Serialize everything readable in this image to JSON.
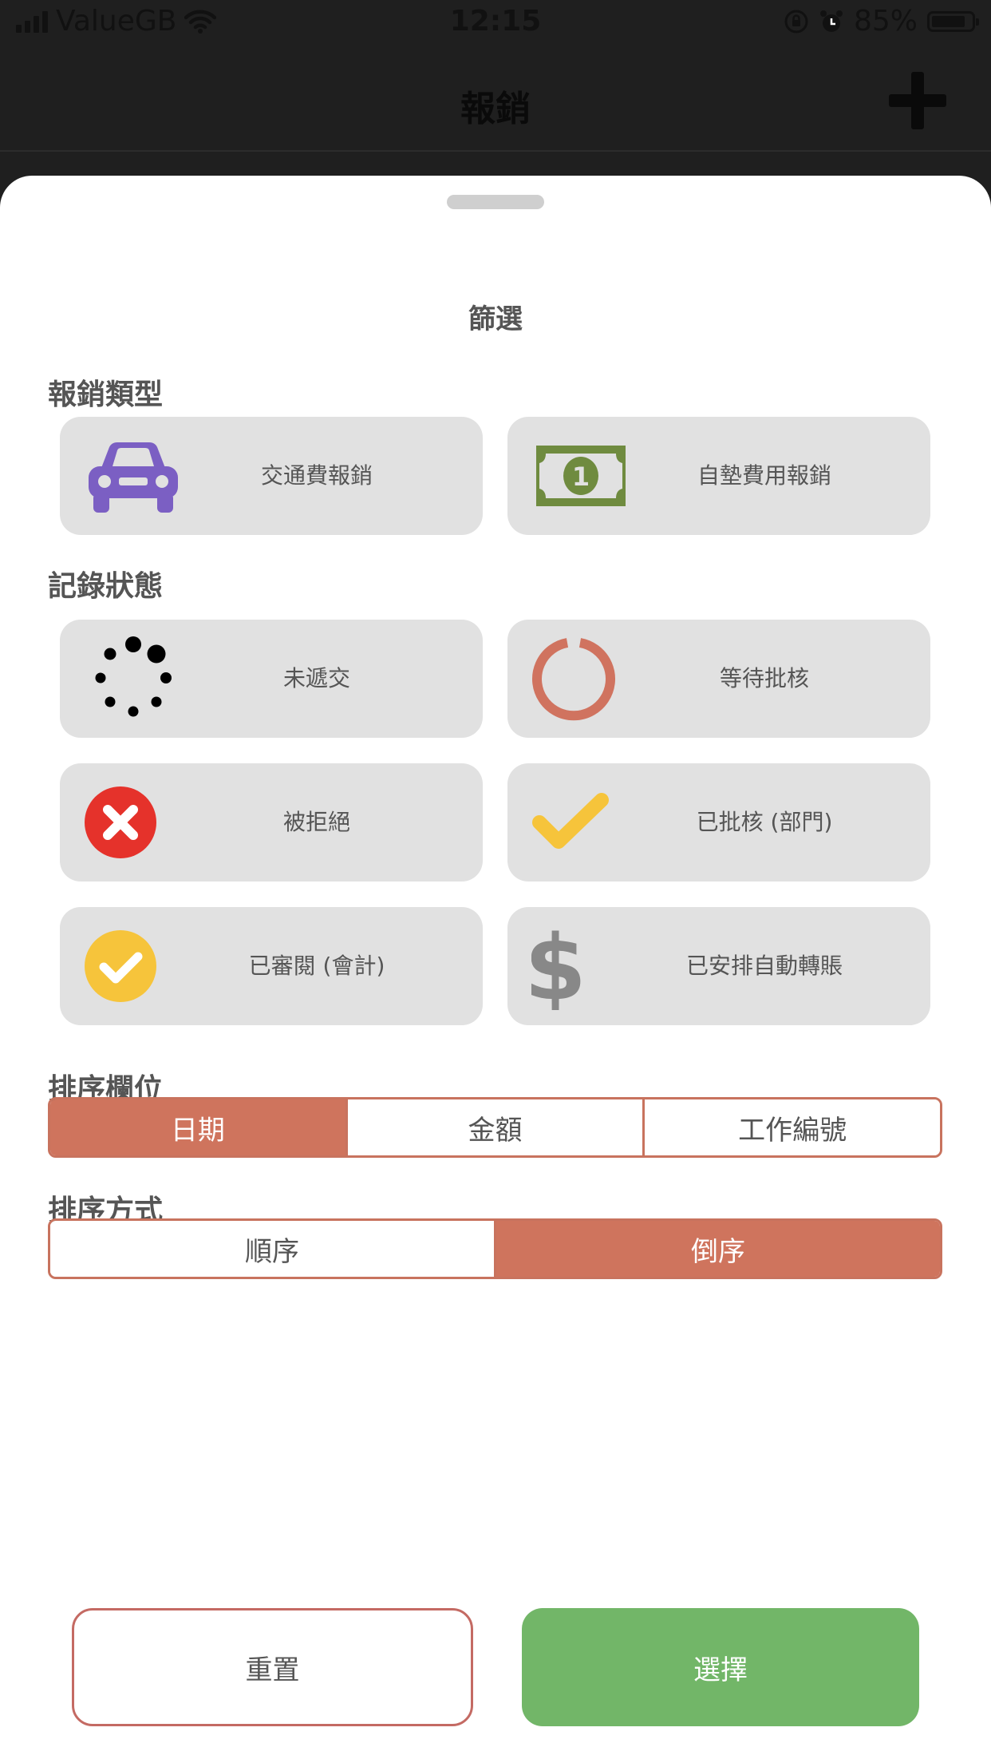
{
  "status_bar": {
    "carrier": "ValueGB",
    "time": "12:15",
    "battery": "85%",
    "battery_level": 0.85
  },
  "nav": {
    "title": "報銷",
    "add_icon": "plus-icon"
  },
  "sheet": {
    "title": "篩選",
    "type_section": {
      "label": "報銷類型",
      "items": [
        {
          "label": "交通費報銷",
          "icon": "car-icon",
          "color": "#7b5fc3"
        },
        {
          "label": "自墊費用報銷",
          "icon": "banknote-icon",
          "color": "#6f8b3f"
        }
      ]
    },
    "status_section": {
      "label": "記錄狀態",
      "items": [
        {
          "label": "未遞交",
          "icon": "spinner-dots-icon",
          "color": "#000000"
        },
        {
          "label": "等待批核",
          "icon": "ring-icon",
          "color": "#d0735f"
        },
        {
          "label": "被拒絕",
          "icon": "x-circle-icon",
          "color": "#e5322b"
        },
        {
          "label": "已批核 (部門)",
          "icon": "checkmark-icon",
          "color": "#f6c43b"
        },
        {
          "label": "已審閱 (會計)",
          "icon": "check-circle-icon",
          "color": "#f6c43b"
        },
        {
          "label": "已安排自動轉賬",
          "icon": "dollar-sign-icon",
          "color": "#888888"
        }
      ]
    },
    "sort_field": {
      "label": "排序欄位",
      "options": [
        "日期",
        "金額",
        "工作編號"
      ],
      "selected": "日期"
    },
    "sort_order": {
      "label": "排序方式",
      "options": [
        "順序",
        "倒序"
      ],
      "selected": "倒序"
    },
    "reset_label": "重置",
    "select_label": "選擇"
  }
}
